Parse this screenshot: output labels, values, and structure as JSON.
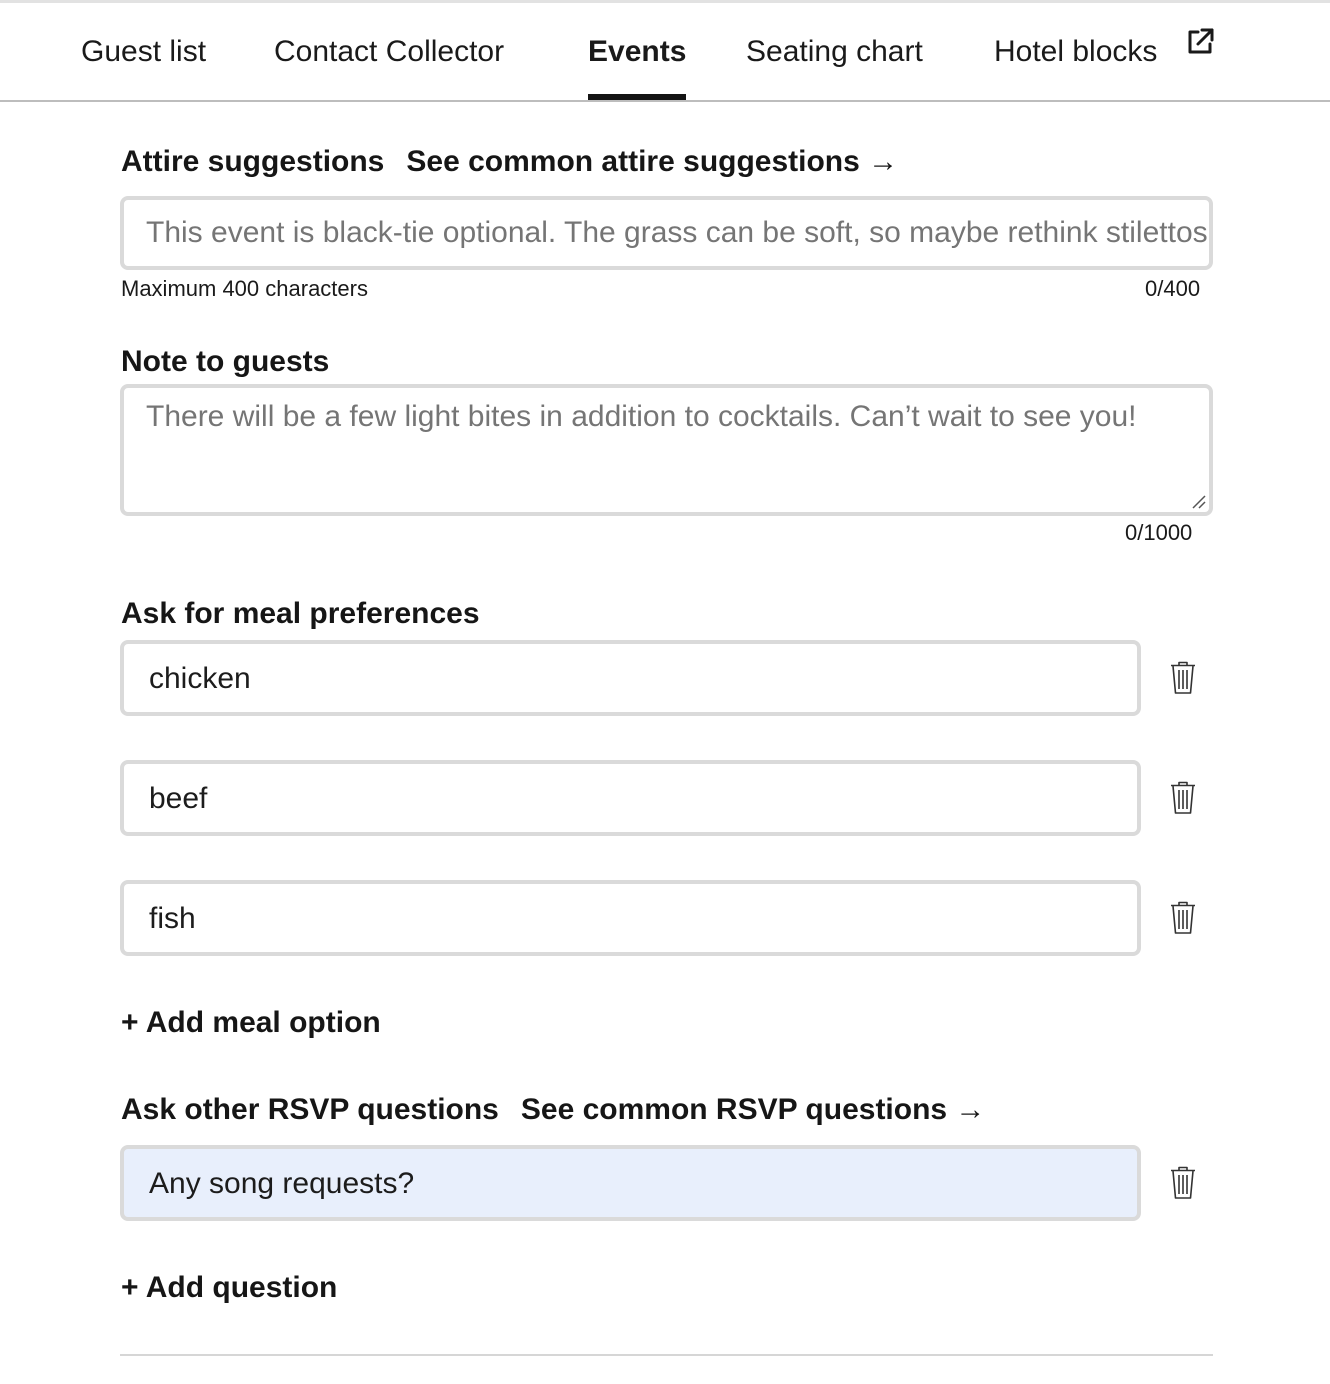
{
  "tabs": [
    {
      "label": "Guest list",
      "active": false
    },
    {
      "label": "Contact Collector",
      "active": false
    },
    {
      "label": "Events",
      "active": true
    },
    {
      "label": "Seating chart",
      "active": false
    },
    {
      "label": "Hotel blocks",
      "active": false,
      "icon": "external-link-icon"
    }
  ],
  "attire": {
    "label": "Attire suggestions",
    "link": "See common attire suggestions →",
    "placeholder": "This event is black-tie optional. The grass can be soft, so maybe rethink stilettos.",
    "value": "",
    "hint": "Maximum 400 characters",
    "counter": "0/400"
  },
  "note": {
    "label": "Note to guests",
    "placeholder": "There will be a few light bites in addition to cocktails. Can’t wait to see you!",
    "value": "",
    "counter": "0/1000"
  },
  "meals": {
    "label": "Ask for meal preferences",
    "options": [
      {
        "value": "chicken",
        "delete_icon": "trash-icon"
      },
      {
        "value": "beef",
        "delete_icon": "trash-icon"
      },
      {
        "value": "fish",
        "delete_icon": "trash-icon"
      }
    ],
    "add_label": "+ Add meal option"
  },
  "rsvp": {
    "label": "Ask other RSVP questions",
    "link": "See common RSVP questions →",
    "questions": [
      {
        "value": "Any song requests?",
        "delete_icon": "trash-icon",
        "autofill_bg": "#e8effc"
      }
    ],
    "add_label": "+ Add question"
  },
  "colors": {
    "text": "#1a1a1a",
    "placeholder": "#757575",
    "border": "#dadada",
    "active_tab_underline": "#141414"
  }
}
